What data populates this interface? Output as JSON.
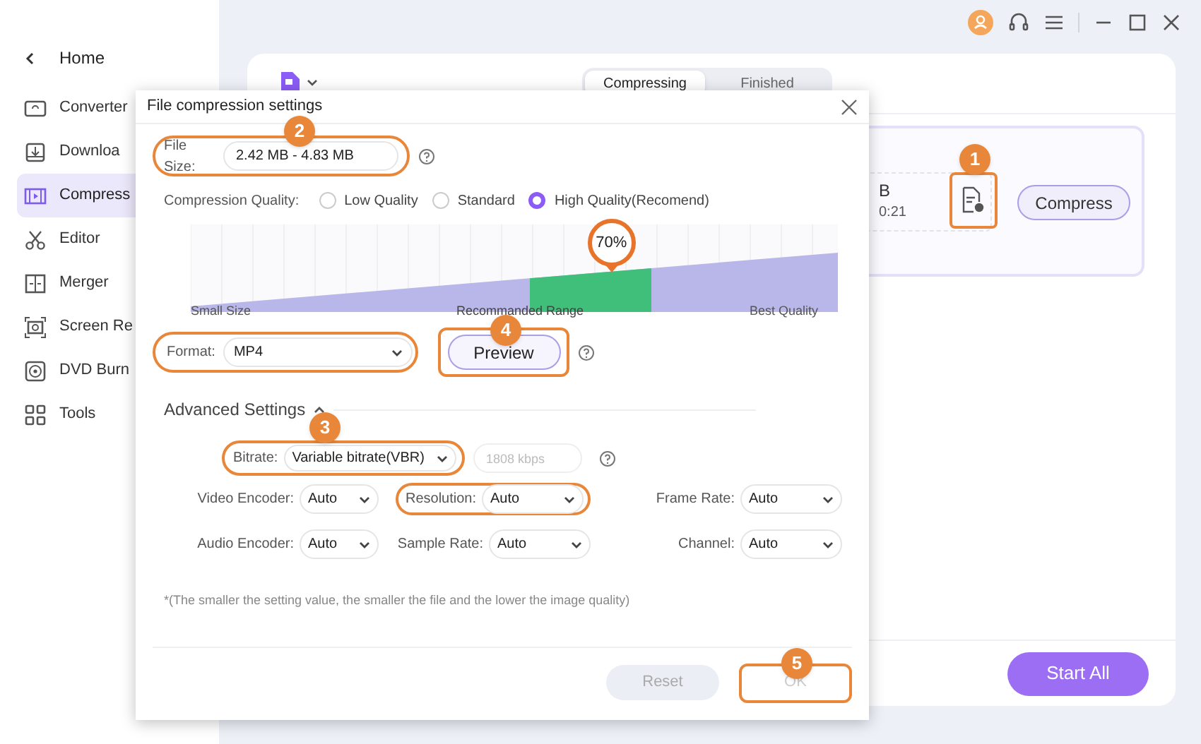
{
  "sidebar": {
    "back": "Home",
    "items": [
      {
        "label": "Converter",
        "selected": false
      },
      {
        "label": "Downloa",
        "selected": false
      },
      {
        "label": "Compress",
        "selected": true
      },
      {
        "label": "Editor",
        "selected": false
      },
      {
        "label": "Merger",
        "selected": false
      },
      {
        "label": "Screen Re",
        "selected": false
      },
      {
        "label": "DVD Burn",
        "selected": false
      },
      {
        "label": "Tools",
        "selected": false
      }
    ]
  },
  "main": {
    "tabs": [
      {
        "label": "Compressing",
        "selected": true
      },
      {
        "label": "Finished",
        "selected": false
      }
    ],
    "file_item": {
      "size": "B",
      "duration": "0:21"
    },
    "compress_button": "Compress",
    "start_all_button": "Start All"
  },
  "dialog": {
    "title": "File compression settings",
    "file_size": {
      "label": "File Size:",
      "value": "2.42 MB - 4.83 MB"
    },
    "quality": {
      "label": "Compression Quality:",
      "options": [
        {
          "label": "Low Quality",
          "selected": false
        },
        {
          "label": "Standard",
          "selected": false
        },
        {
          "label": "High Quality(Recomend)",
          "selected": true
        }
      ]
    },
    "slider": {
      "level": 0.65,
      "reading": "70%",
      "labels": [
        "Small Size",
        "Recommanded Range",
        "Best Quality"
      ]
    },
    "format": {
      "label": "Format:",
      "value": "MP4"
    },
    "preview_button": "Preview",
    "advanced": {
      "title": "Advanced Settings",
      "expanded": true
    },
    "bitrate": {
      "label": "Bitrate:",
      "value": "Variable bitrate(VBR)",
      "placeholder": "1808 kbps"
    },
    "settings": [
      {
        "label": "Video Encoder:",
        "value": "Auto",
        "highlighted": false
      },
      {
        "label": "Resolution:",
        "value": "Auto",
        "highlighted": true
      },
      {
        "label": "Frame Rate:",
        "value": "Auto",
        "highlighted": false
      },
      {
        "label": "Audio Encoder:",
        "value": "Auto",
        "highlighted": false
      },
      {
        "label": "Sample Rate:",
        "value": "Auto",
        "highlighted": false
      },
      {
        "label": "Channel:",
        "value": "Auto",
        "highlighted": false
      }
    ],
    "note": "*(The smaller the setting value, the smaller the file and the lower the image quality)",
    "buttons": [
      {
        "label": "Reset"
      },
      {
        "label": "OK"
      }
    ]
  },
  "callouts": [
    {
      "number": "1"
    },
    {
      "number": "2"
    },
    {
      "number": "3"
    },
    {
      "number": "4"
    },
    {
      "number": "5"
    }
  ]
}
